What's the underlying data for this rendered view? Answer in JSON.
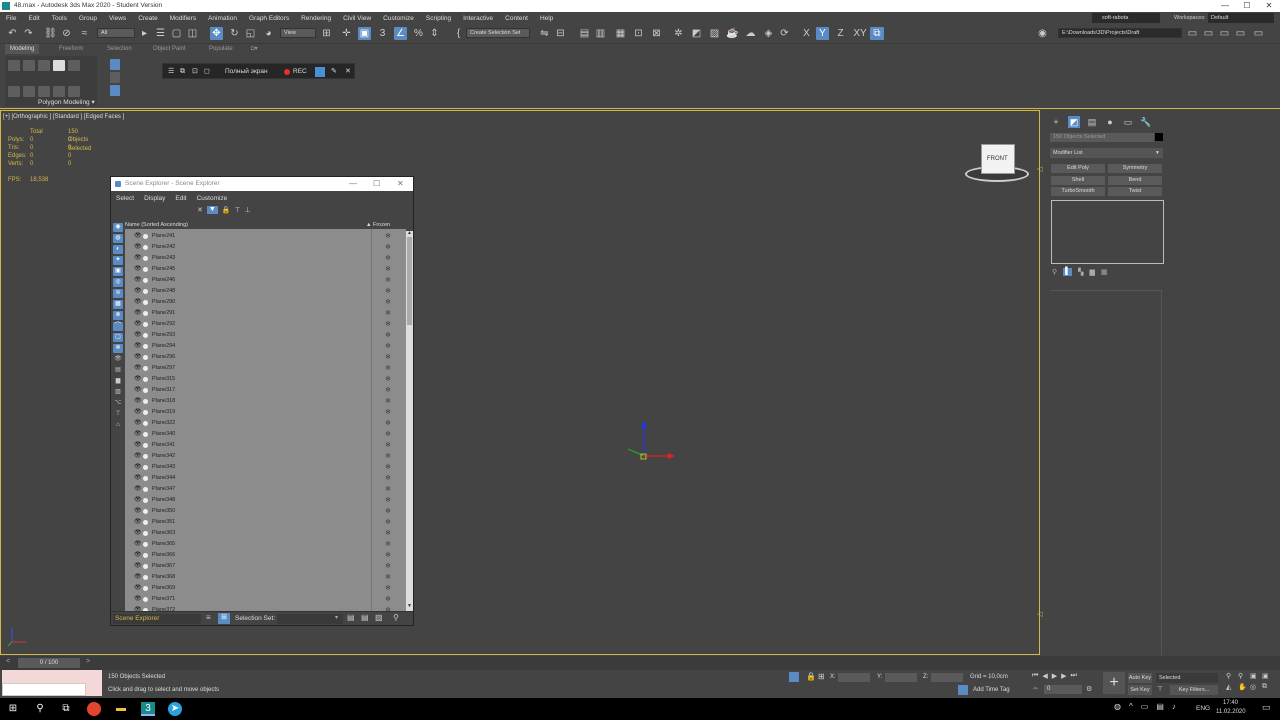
{
  "window": {
    "title": "48.max - Autodesk 3ds Max 2020 - Student Version",
    "controls": [
      "—",
      "☐",
      "✕"
    ]
  },
  "menu": [
    "File",
    "Edit",
    "Tools",
    "Group",
    "Views",
    "Create",
    "Modifiers",
    "Animation",
    "Graph Editors",
    "Rendering",
    "Civil View",
    "Customize",
    "Scripting",
    "Interactive",
    "Content",
    "Help"
  ],
  "toolbar": {
    "filter_dropdown": "All",
    "view_dropdown": "View",
    "selection_set": "Create Selection Set",
    "axis_x": "X",
    "axis_y": "Y",
    "axis_z": "Z",
    "axis_xy": "XY",
    "user": "soft-rabota",
    "workspaces_label": "Workspaces:",
    "workspace": "Default",
    "project_path": "E:\\Downloads\\3D\\Projects\\Draft"
  },
  "ribbon": {
    "tabs": [
      "Modeling",
      "Freeform",
      "Selection",
      "Object Paint",
      "Populate"
    ],
    "panel_label": "Polygon Modeling"
  },
  "floatbar": {
    "fullscreen": "Полный экран",
    "rec": "REC"
  },
  "viewport": {
    "label": "[+] [Orthographic ] [Standard ] [Edged Faces ]",
    "stats_header_total": "Total",
    "stats_header_selected": "150 Objects Selected",
    "stats": [
      {
        "label": "Polys:",
        "total": "0",
        "sel": "0"
      },
      {
        "label": "Tris:",
        "total": "0",
        "sel": "0"
      },
      {
        "label": "Edges:",
        "total": "0",
        "sel": "0"
      },
      {
        "label": "Verts:",
        "total": "0",
        "sel": "0"
      }
    ],
    "fps_label": "FPS:",
    "fps_value": "18,538",
    "viewcube_label": "FRONT"
  },
  "command_panel": {
    "object_name": "150 Objects Selected",
    "modifier_list": "Modifier List",
    "buttons": [
      "Edit Poly",
      "Symmetry",
      "Shell",
      "Bend",
      "TurboSmooth",
      "Twist"
    ]
  },
  "scene_explorer": {
    "title": "Scene Explorer - Scene Explorer",
    "menu": [
      "Select",
      "Display",
      "Edit",
      "Customize"
    ],
    "col_name": "Name (Sorted Ascending)",
    "col_frozen": "▲ Frozen",
    "rows": [
      "Plane241",
      "Plane242",
      "Plane243",
      "Plane245",
      "Plane246",
      "Plane248",
      "Plane290",
      "Plane291",
      "Plane292",
      "Plane293",
      "Plane294",
      "Plane296",
      "Plane297",
      "Plane315",
      "Plane317",
      "Plane318",
      "Plane319",
      "Plane322",
      "Plane340",
      "Plane341",
      "Plane342",
      "Plane343",
      "Plane344",
      "Plane347",
      "Plane348",
      "Plane350",
      "Plane351",
      "Plane363",
      "Plane365",
      "Plane366",
      "Plane367",
      "Plane368",
      "Plane369",
      "Plane371",
      "Plane372"
    ],
    "footer_name": "Scene Explorer",
    "selection_set_label": "Selection Set:"
  },
  "timeline": {
    "frame": "0 / 100"
  },
  "status": {
    "selected": "150 Objects Selected",
    "prompt": "Click and drag to select and move objects",
    "x_label": "X:",
    "y_label": "Y:",
    "z_label": "Z:",
    "grid": "Grid = 10,0cm",
    "add_time_tag": "Add Time Tag",
    "auto_key": "Auto Key",
    "set_key": "Set Key",
    "selected_dd": "Selected",
    "key_filters": "Key Filters...",
    "frame_value": "0"
  },
  "taskbar": {
    "lang": "ENG",
    "time": "17:40",
    "date": "11.02.2020"
  },
  "colors": {
    "accent": "#5b8bc5",
    "highlight": "#d4b84a",
    "viewport_bg": "#444444"
  }
}
